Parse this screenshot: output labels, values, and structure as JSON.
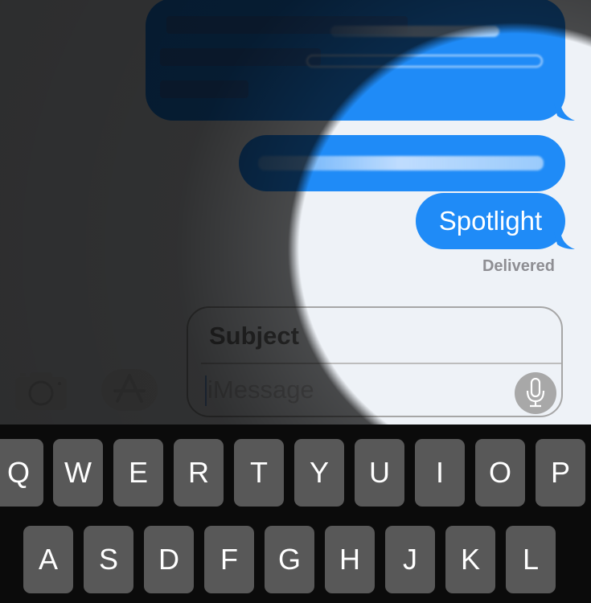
{
  "conversation": {
    "messages": [
      {
        "id": "msg-1",
        "text": "",
        "redacted": true,
        "sender": "me"
      },
      {
        "id": "msg-2",
        "text": "",
        "redacted": true,
        "sender": "me"
      },
      {
        "id": "msg-3",
        "text": "Spotlight",
        "redacted": false,
        "sender": "me"
      }
    ],
    "status": "Delivered",
    "bubble_color": "#1f8bf7"
  },
  "input_bar": {
    "camera_icon": "camera-icon",
    "apps_icon": "app-store-icon",
    "subject_placeholder": "Subject",
    "message_placeholder": "iMessage",
    "mic_icon": "microphone-icon"
  },
  "keyboard": {
    "row1": [
      "Q",
      "W",
      "E",
      "R",
      "T",
      "Y",
      "U",
      "I",
      "O",
      "P"
    ],
    "row2": [
      "A",
      "S",
      "D",
      "F",
      "G",
      "H",
      "J",
      "K",
      "L"
    ]
  }
}
